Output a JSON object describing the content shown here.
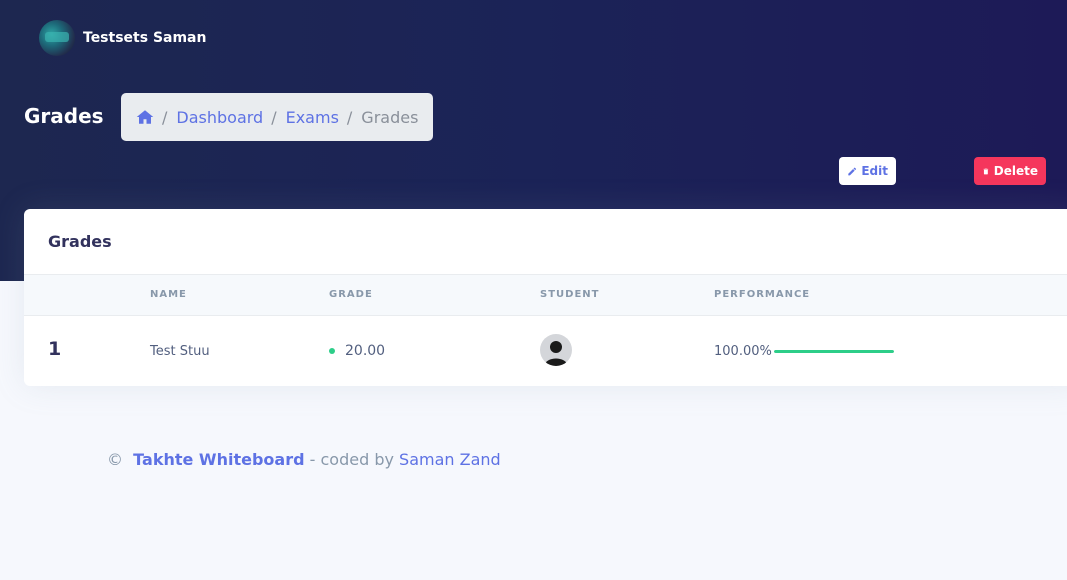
{
  "header": {
    "user_name": "Testsets Saman",
    "page_title": "Grades",
    "breadcrumb": {
      "items": [
        "Dashboard",
        "Exams"
      ],
      "active": "Grades",
      "separator": "/"
    },
    "actions": {
      "edit_label": "Edit",
      "delete_label": "Delete"
    }
  },
  "card": {
    "title": "Grades",
    "columns": [
      "Name",
      "Grade",
      "Student",
      "Performance"
    ],
    "rows": [
      {
        "index": "1",
        "name": "Test Stuu",
        "grade": "20.00",
        "performance_label": "100.00%",
        "performance_fraction": 1.0
      }
    ]
  },
  "footer": {
    "copyright": "©",
    "brand": "Takhte Whiteboard",
    "middle": "- coded by",
    "author": "Saman Zand"
  },
  "colors": {
    "accent": "#5e72e4",
    "danger": "#f5365c",
    "success": "#2dce89"
  },
  "icons": [
    "home-icon",
    "pencil-icon",
    "trash-icon",
    "user-avatar-icon"
  ]
}
